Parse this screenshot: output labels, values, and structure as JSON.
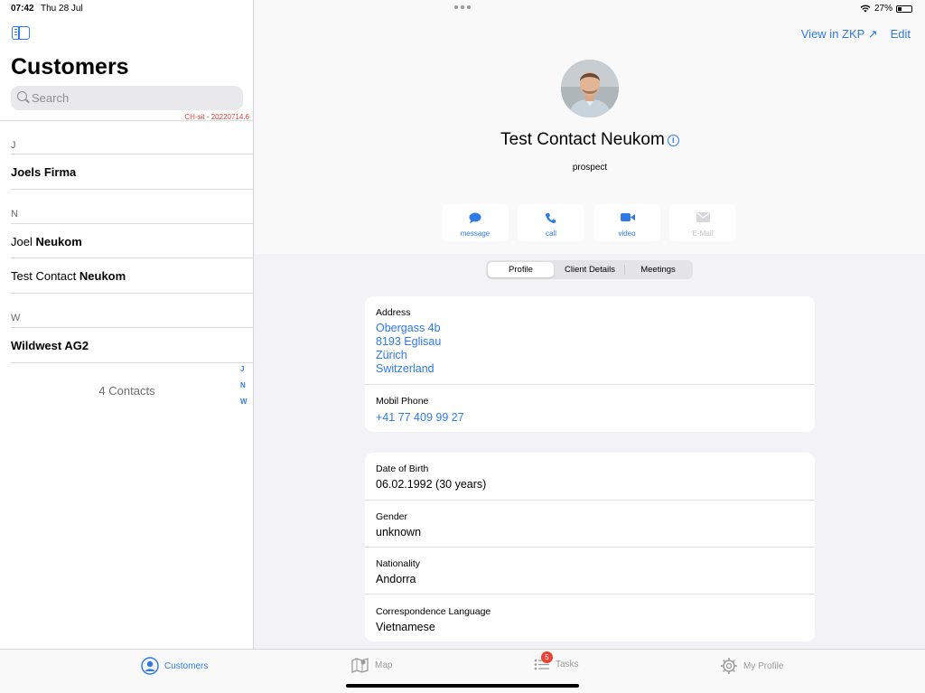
{
  "status_bar": {
    "time": "07:42",
    "date": "Thu 28 Jul",
    "battery": "27%"
  },
  "sidebar": {
    "title": "Customers",
    "search_placeholder": "Search",
    "version": "CH-sit - 20220714.6",
    "sections": [
      {
        "letter": "J",
        "rows": [
          {
            "first": "Joels Firma",
            "last": ""
          }
        ]
      },
      {
        "letter": "N",
        "rows": [
          {
            "first": "Joel",
            "last": "Neukom"
          },
          {
            "first": "Test Contact",
            "last": "Neukom"
          }
        ]
      },
      {
        "letter": "W",
        "rows": [
          {
            "first": "Wildwest AG2",
            "last": ""
          }
        ]
      }
    ],
    "index_letters": [
      "J",
      "N",
      "W"
    ],
    "contacts_count": "4 Contacts"
  },
  "detail": {
    "view_in_zkp": "View in ZKP ↗",
    "edit": "Edit",
    "name": "Test Contact Neukom",
    "status": "prospect",
    "actions": [
      {
        "label": "message",
        "icon": "message-icon",
        "enabled": true
      },
      {
        "label": "call",
        "icon": "phone-icon",
        "enabled": true
      },
      {
        "label": "video",
        "icon": "video-icon",
        "enabled": true
      },
      {
        "label": "E-Mail",
        "icon": "mail-icon",
        "enabled": false
      }
    ],
    "tabs": [
      "Profile",
      "Client Details",
      "Meetings"
    ],
    "active_tab": "Profile",
    "address": {
      "label": "Address",
      "lines": [
        "Obergass 4b",
        "8193 Eglisau",
        "Zürich",
        "Switzerland"
      ]
    },
    "mobile": {
      "label": "Mobil Phone",
      "value": "+41 77 409 99 27"
    },
    "personal": [
      {
        "label": "Date of Birth",
        "value": "06.02.1992 (30 years)"
      },
      {
        "label": "Gender",
        "value": "unknown"
      },
      {
        "label": "Nationality",
        "value": "Andorra"
      },
      {
        "label": "Correspondence Language",
        "value": "Vietnamese"
      }
    ]
  },
  "tab_bar": {
    "items": [
      {
        "label": "Customers",
        "icon": "person-circle-icon",
        "active": true
      },
      {
        "label": "Map",
        "icon": "map-icon",
        "active": false
      },
      {
        "label": "Tasks",
        "icon": "list-icon",
        "active": false,
        "badge": "5"
      },
      {
        "label": "My Profile",
        "icon": "gear-icon",
        "active": false
      }
    ]
  },
  "colors": {
    "accent": "#2f7ae5",
    "badge": "#ea4335",
    "version": "#e3453a"
  }
}
